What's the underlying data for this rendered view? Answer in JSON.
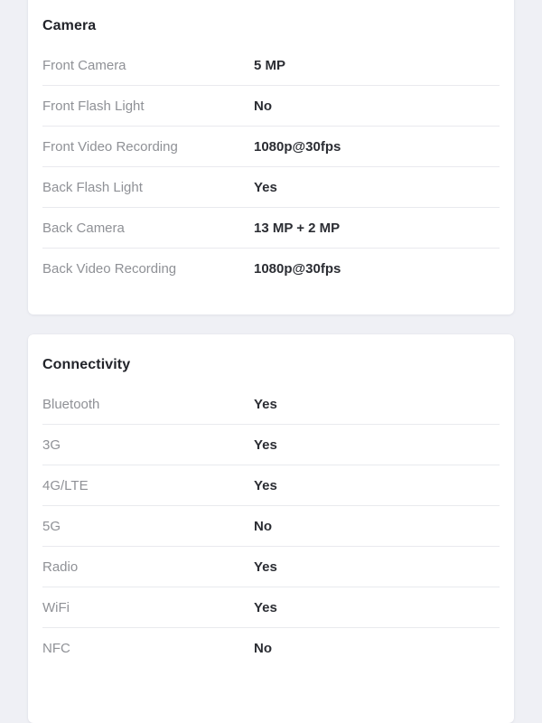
{
  "page": {
    "background_color": "#eff0f5",
    "card_background_color": "#ffffff",
    "label_color": "#8f9196",
    "value_color": "#2b2d33",
    "divider_color": "#e9eaee"
  },
  "sections": [
    {
      "title": "Camera",
      "rows": [
        {
          "label": "Front Camera",
          "value": "5 MP"
        },
        {
          "label": "Front Flash Light",
          "value": "No"
        },
        {
          "label": "Front Video Recording",
          "value": "1080p@30fps"
        },
        {
          "label": "Back Flash Light",
          "value": "Yes"
        },
        {
          "label": "Back Camera",
          "value": "13 MP + 2 MP"
        },
        {
          "label": "Back Video Recording",
          "value": "1080p@30fps"
        }
      ]
    },
    {
      "title": "Connectivity",
      "rows": [
        {
          "label": "Bluetooth",
          "value": "Yes"
        },
        {
          "label": "3G",
          "value": "Yes"
        },
        {
          "label": "4G/LTE",
          "value": "Yes"
        },
        {
          "label": "5G",
          "value": "No"
        },
        {
          "label": "Radio",
          "value": "Yes"
        },
        {
          "label": "WiFi",
          "value": "Yes"
        },
        {
          "label": "NFC",
          "value": "No"
        }
      ]
    }
  ]
}
